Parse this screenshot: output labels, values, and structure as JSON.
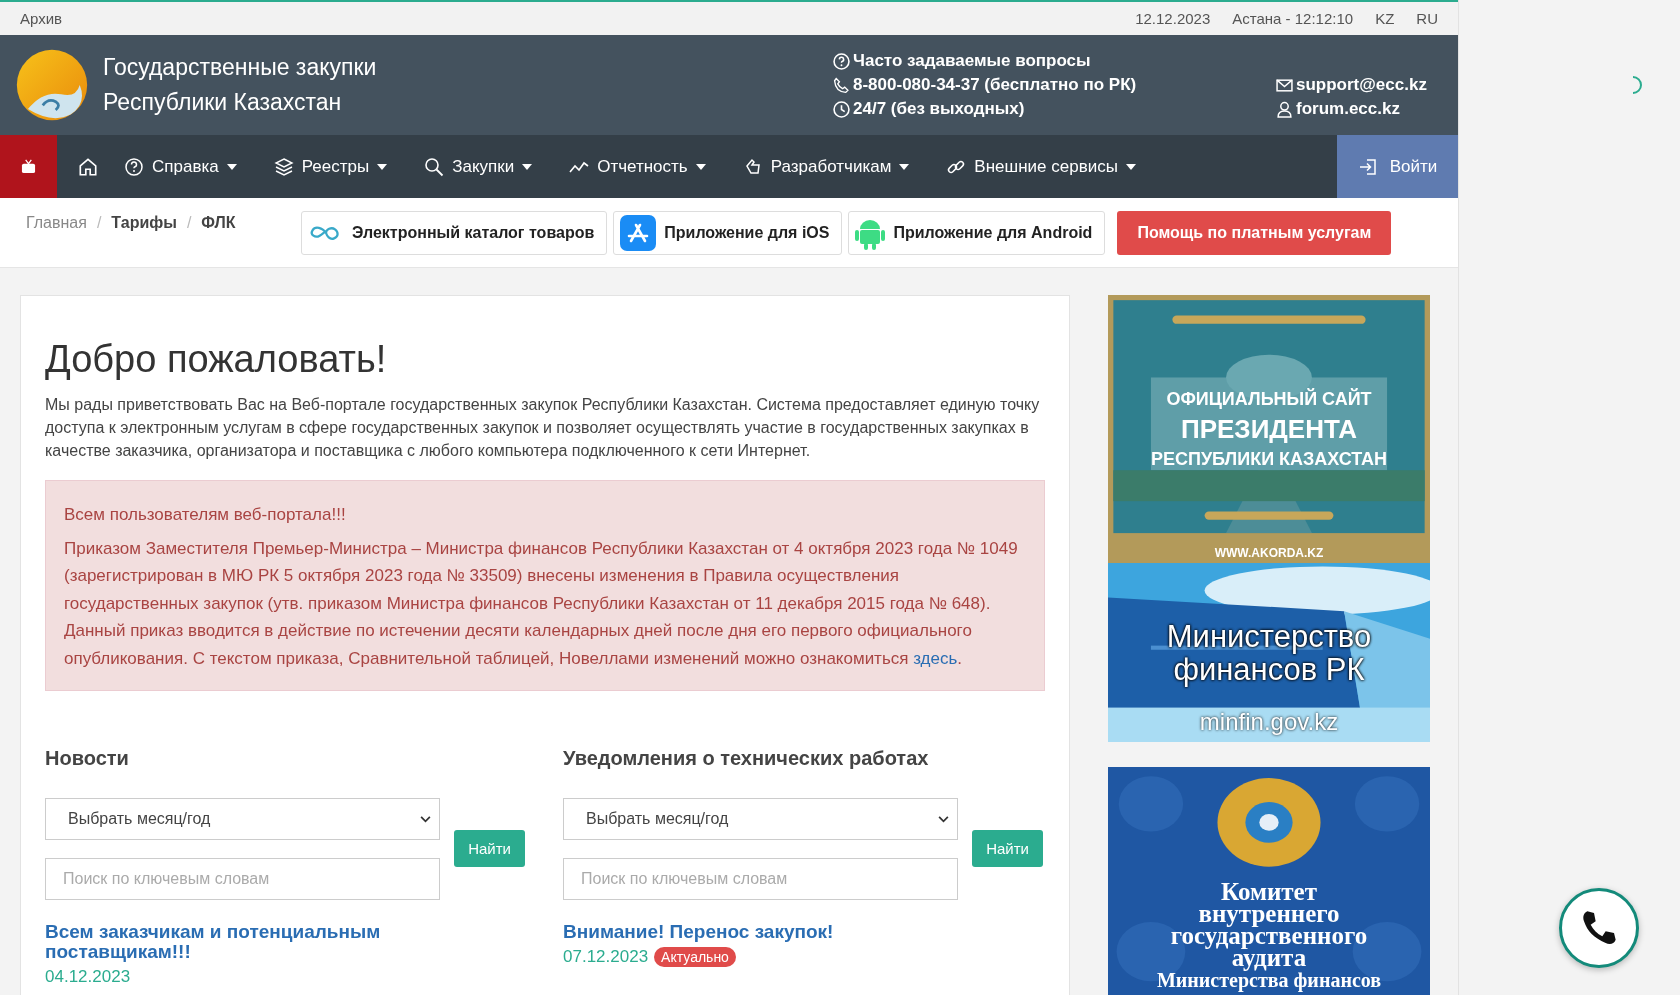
{
  "top_bar": {
    "link": "Архив",
    "date": "12.12.2023",
    "city_time": "Астана - 12:12:10",
    "languages": [
      "KZ",
      "RU"
    ]
  },
  "header": {
    "title_lines": [
      "Государственные закупки",
      "Республики Казахстан"
    ],
    "contacts": [
      {
        "kind": "faq",
        "text": "Часто задаваемые вопросы"
      },
      {
        "kind": "phone",
        "text": "8-800-080-34-37 (бесплатно по РК)"
      },
      {
        "kind": "clock",
        "text": "24/7 (без выходных)"
      }
    ],
    "links": [
      {
        "kind": "mail",
        "text": "support@ecc.kz"
      },
      {
        "kind": "forum",
        "text": "forum.ecc.kz"
      }
    ]
  },
  "nav": {
    "items": [
      {
        "kind": "help",
        "label": "Справка"
      },
      {
        "kind": "layers",
        "label": "Реестры"
      },
      {
        "kind": "search",
        "label": "Закупки"
      },
      {
        "kind": "chart",
        "label": "Отчетность"
      },
      {
        "kind": "dev",
        "label": "Разработчикам"
      },
      {
        "kind": "link",
        "label": "Внешние сервисы"
      }
    ],
    "login": "Войти"
  },
  "breadcrumbs": {
    "separator": "/",
    "items": [
      {
        "label": "Главная",
        "link": true
      },
      {
        "label": "Тарифы",
        "link": false
      },
      {
        "label": "ФЛК",
        "link": false
      }
    ]
  },
  "app_buttons": [
    {
      "kind": "catalog",
      "label": "Электронный каталог товаров"
    },
    {
      "kind": "ios",
      "label": "Приложение для iOS"
    },
    {
      "kind": "android",
      "label": "Приложение для Android"
    },
    {
      "kind": "help",
      "label": "Помощь по платным услугам"
    }
  ],
  "welcome": {
    "title": "Добро пожаловать!",
    "text": "Мы рады приветствовать Вас на Веб-портале государственных закупок Республики Казахстан. Система предоставляет единую точку доступа к электронным услугам в сфере государственных закупок и позволяет осуществлять участие в государственных закупках в качестве заказчика, организатора и поставщика с любого компьютера подключенного к сети Интернет."
  },
  "alert": {
    "heading": "Всем пользователям веб-портала!!!",
    "text": "Приказом Заместителя Премьер-Министра – Министра финансов Республики Казахстан от 4 октября 2023 года № 1049 (зарегистрирован в МЮ РК 5 октября 2023 года № 33509) внесены изменения в Правила осуществления государственных закупок (утв. приказом Министра финансов Республики Казахстан от 11 декабря 2015 года № 648). Данный приказ вводится в действие по истечении десяти календарных дней после дня его первого официального опубликования. С текстом приказа, Сравнительной таблицей, Новеллами изменений можно ознакомиться ",
    "link": "здесь",
    "after": "."
  },
  "sections": [
    {
      "title": "Новости",
      "select": "Выбрать месяц/год",
      "button": "Найти",
      "placeholder": "Поиск по ключевым словам",
      "item": {
        "title": "Всем заказчикам и потенциальным поставщикам!!!",
        "date": "04.12.2023"
      }
    },
    {
      "title": "Уведомления о технических работах",
      "select": "Выбрать месяц/год",
      "button": "Найти",
      "placeholder": "Поиск по ключевым словам",
      "item": {
        "title": "Внимание! Перенос закупок!",
        "date": "07.12.2023",
        "badge": "Актуально"
      }
    }
  ],
  "banners": [
    {
      "kind": "akorda",
      "lines": [
        "ОФИЦИАЛЬНЫЙ САЙТ",
        "ПРЕЗИДЕНТА",
        "РЕСПУБЛИКИ КАЗАХСТАН"
      ],
      "footer": "WWW.AKORDA.KZ"
    },
    {
      "kind": "minfin",
      "lines": [
        "Министерство",
        "финансов РК"
      ],
      "footer": "minfin.gov.kz"
    },
    {
      "kind": "audit",
      "lines": [
        "Комитет",
        "внутреннего",
        "государственного",
        "аудита",
        "Министерства финансов"
      ]
    }
  ]
}
